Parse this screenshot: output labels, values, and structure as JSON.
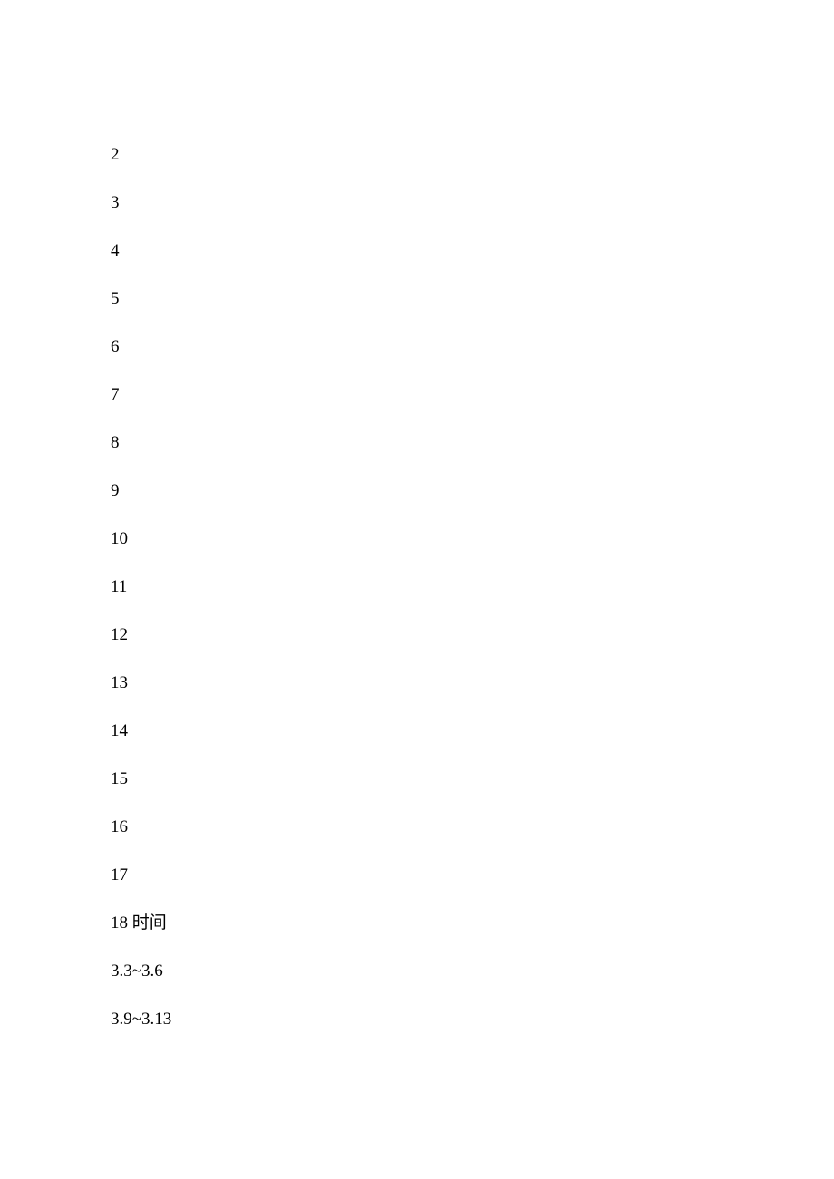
{
  "lines": [
    "2",
    "3",
    "4",
    "5",
    "6",
    "7",
    "8",
    "9",
    "10",
    "11",
    "12",
    "13",
    "14",
    "15",
    "16",
    "17",
    "18 时间",
    "3.3~3.6",
    "3.9~3.13"
  ]
}
